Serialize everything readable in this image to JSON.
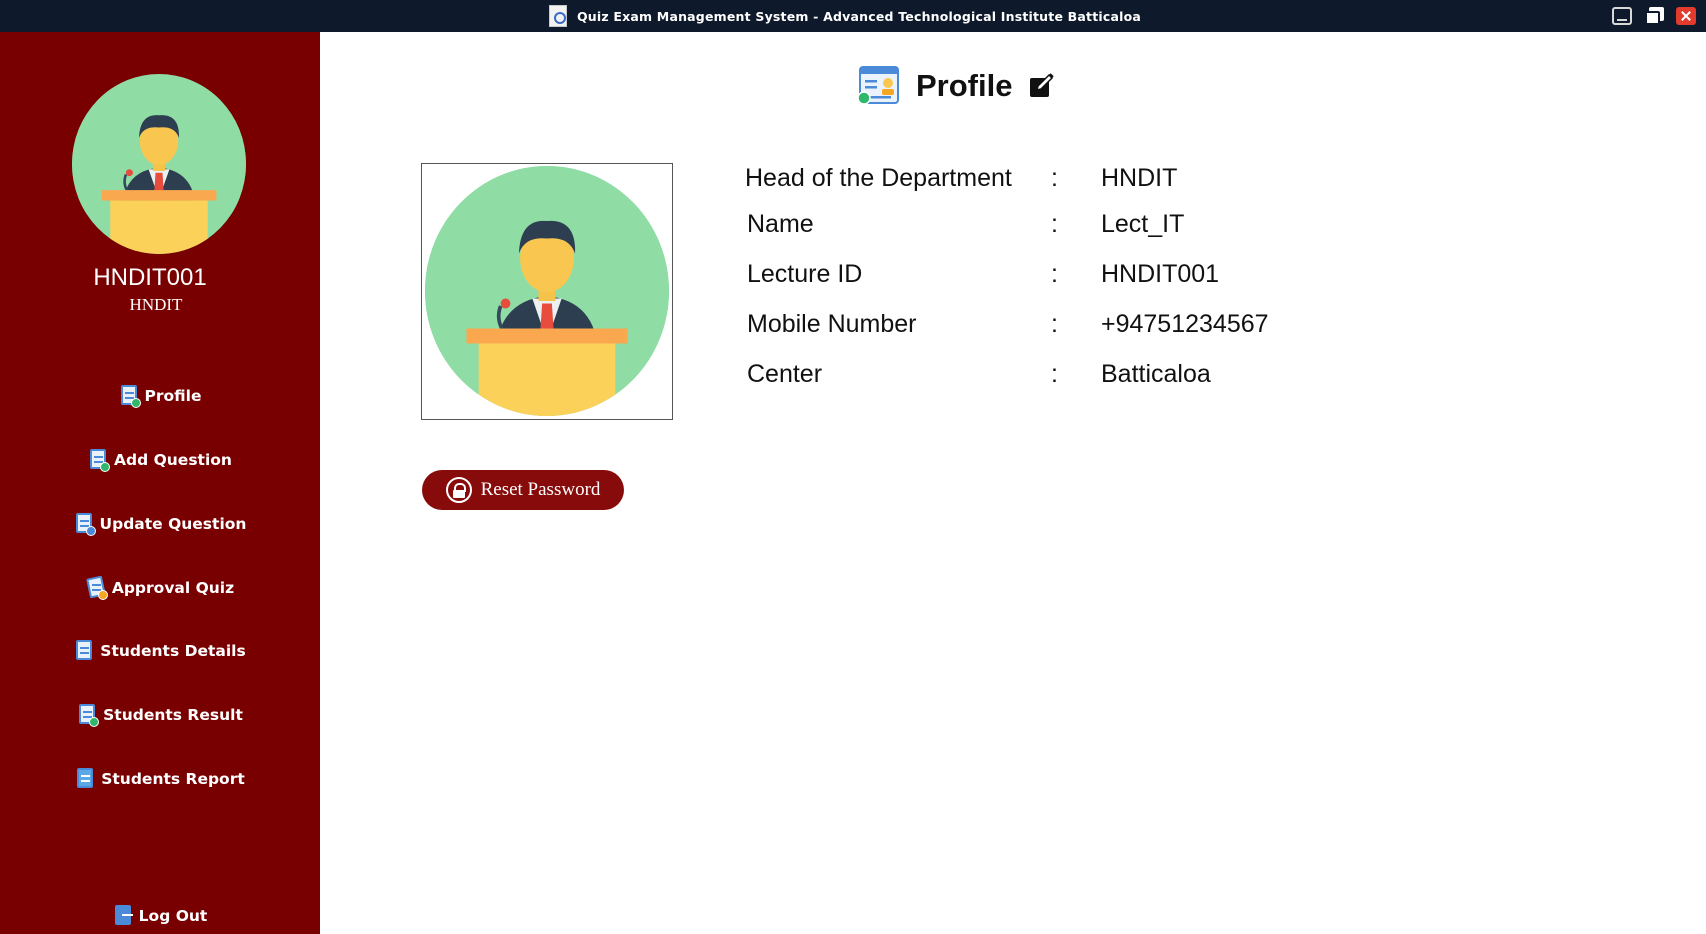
{
  "window": {
    "title": "Quiz Exam Management System - Advanced Technological Institute  Batticaloa",
    "controls": [
      "minimize-icon",
      "maximize-icon",
      "close-icon"
    ]
  },
  "sidebar": {
    "user_id": "HNDIT001",
    "department": "HNDIT",
    "items": [
      {
        "label": "Profile",
        "icon": "profile-icon"
      },
      {
        "label": "Add Question",
        "icon": "add-question-icon"
      },
      {
        "label": "Update Question",
        "icon": "update-question-icon"
      },
      {
        "label": "Approval Quiz",
        "icon": "approval-quiz-icon"
      },
      {
        "label": "Students Details",
        "icon": "students-details-icon"
      },
      {
        "label": "Students Result",
        "icon": "students-result-icon"
      },
      {
        "label": "Students Report",
        "icon": "students-report-icon"
      }
    ],
    "logout_label": "Log Out"
  },
  "main": {
    "title": "Profile",
    "info_separator": ":",
    "fields": [
      {
        "label": "Head of the Department",
        "value": "HNDIT"
      },
      {
        "label": "Name",
        "value": "Lect_IT"
      },
      {
        "label": "Lecture ID",
        "value": "HNDIT001"
      },
      {
        "label": "Mobile Number",
        "value": "+94751234567"
      },
      {
        "label": "Center",
        "value": "Batticaloa"
      }
    ],
    "reset_password_label": "Reset Password"
  },
  "colors": {
    "sidebar_bg": "#780000",
    "titlebar_bg": "#0e1a2b",
    "button_bg": "#870b0b",
    "avatar_bg": "#8fdca5"
  }
}
